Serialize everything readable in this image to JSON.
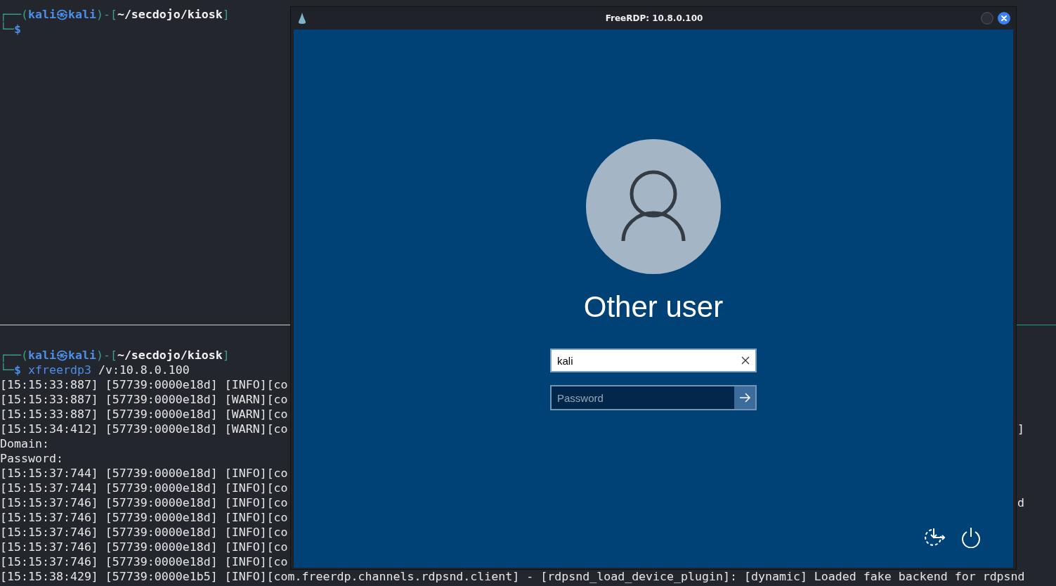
{
  "terminal_top": {
    "prompt": [
      [
        {
          "kind": "frame",
          "text": "┌──("
        },
        {
          "kind": "user",
          "text": "kali㉿kali"
        },
        {
          "kind": "frame",
          "text": ")-["
        },
        {
          "kind": "path",
          "text": "~/secdojo/kiosk"
        },
        {
          "kind": "frame",
          "text": "]"
        }
      ],
      [
        {
          "kind": "frame",
          "text": "└─"
        },
        {
          "kind": "symbol",
          "text": "$"
        }
      ]
    ]
  },
  "terminal_bottom": {
    "prompt": [
      [
        {
          "kind": "frame",
          "text": "┌──("
        },
        {
          "kind": "user",
          "text": "kali㉿kali"
        },
        {
          "kind": "frame",
          "text": ")-["
        },
        {
          "kind": "path",
          "text": "~/secdojo/kiosk"
        },
        {
          "kind": "frame",
          "text": "]"
        }
      ],
      [
        {
          "kind": "frame",
          "text": "└─"
        },
        {
          "kind": "symbol",
          "text": "$"
        },
        {
          "kind": "command",
          "text": "xfreerdp3"
        },
        {
          "kind": "argument",
          "text": "/v:10.8.0.100"
        }
      ]
    ],
    "lines": [
      {
        "text": "[15:15:33:887] [57739:0000e18d] [INFO][co"
      },
      {
        "text": "[15:15:33:887] [57739:0000e18d] [WARN][co"
      },
      {
        "text": "[15:15:33:887] [57739:0000e18d] [WARN][co"
      },
      {
        "text": "[15:15:34:412] [57739:0000e18d] [WARN][co",
        "tail": "]"
      },
      {
        "text": "Domain:"
      },
      {
        "text": "Password:"
      },
      {
        "text": "[15:15:37:744] [57739:0000e18d] [INFO][co"
      },
      {
        "text": "[15:15:37:744] [57739:0000e18d] [INFO][co"
      },
      {
        "text": "[15:15:37:746] [57739:0000e18d] [INFO][co",
        "tail": "d"
      },
      {
        "text": "[15:15:37:746] [57739:0000e18d] [INFO][co"
      },
      {
        "text": "[15:15:37:746] [57739:0000e18d] [INFO][co"
      },
      {
        "text": "[15:15:37:746] [57739:0000e18d] [INFO][co"
      },
      {
        "text": "[15:15:37:746] [57739:0000e18d] [INFO][co"
      },
      {
        "text": "[15:15:38:429] [57739:0000e1b5] [INFO][com.freerdp.channels.rdpsnd.client] - [rdpsnd_load_device_plugin]: [dynamic] Loaded fake backend for rdpsnd"
      }
    ]
  },
  "rdp_window": {
    "title": "FreeRDP: 10.8.0.100",
    "login": {
      "user_name": "Other user",
      "username_field": {
        "value": "kali"
      },
      "password_field": {
        "placeholder": "Password"
      }
    }
  }
}
